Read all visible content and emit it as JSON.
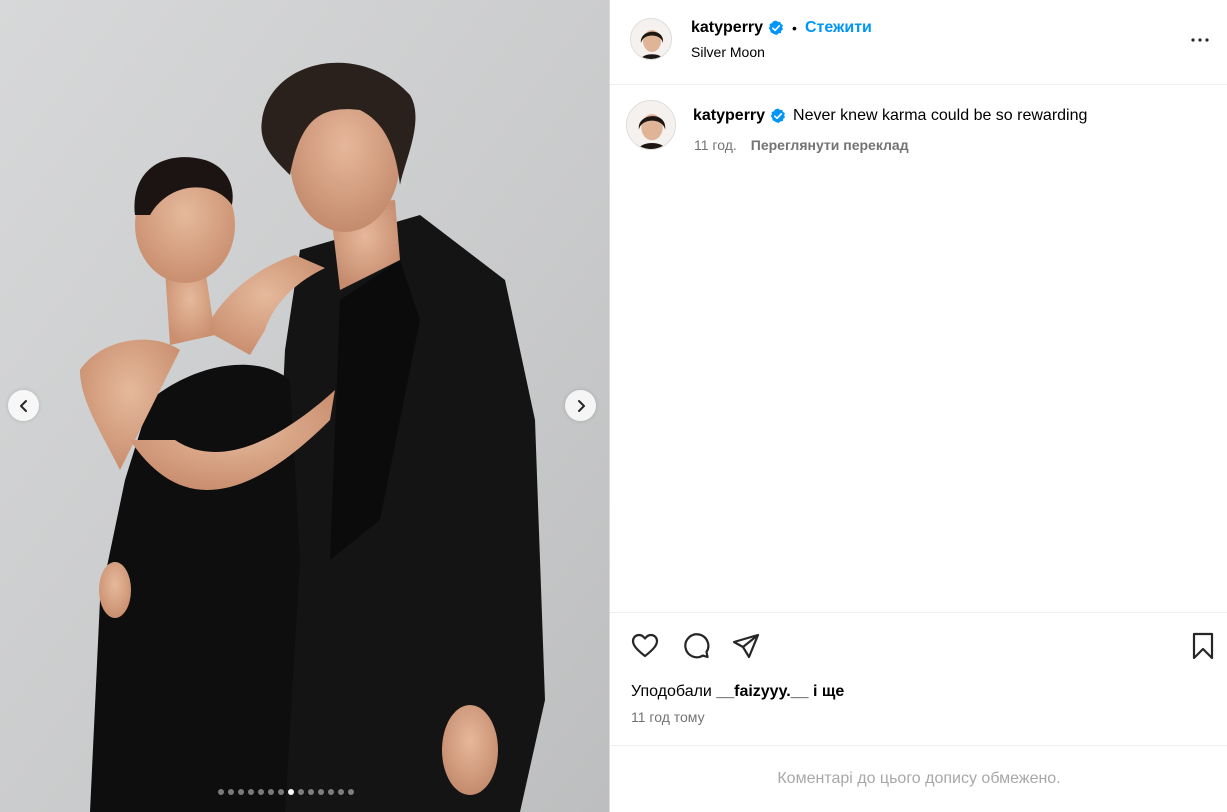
{
  "post": {
    "username": "katyperry",
    "follow_label": "Стежити",
    "separator": "•",
    "location": "Silver Moon",
    "caption": "Never knew karma could be so rewarding",
    "caption_time": "11 год.",
    "translate_label": "Переглянути переклад",
    "likes_prefix": "Уподобали",
    "likes_user": "__faizyyy.__",
    "likes_suffix": "і ще",
    "time_ago": "11 год тому",
    "comments_limited": "Коментарі до цього допису обмежено."
  },
  "carousel": {
    "total_images": 14,
    "active_index": 7
  },
  "icons": {
    "verified": "verified-badge-icon",
    "more": "more-options-icon",
    "like": "heart-icon",
    "comment": "comment-icon",
    "share": "share-icon",
    "save": "bookmark-icon",
    "prev": "chevron-left-icon",
    "next": "chevron-right-icon"
  },
  "colors": {
    "accent": "#0095f6",
    "secondary_text": "#737373",
    "muted_text": "#a8a8a8"
  }
}
